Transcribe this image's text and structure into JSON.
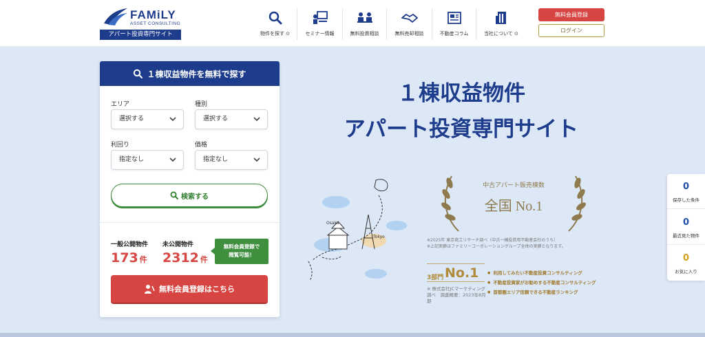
{
  "colors": {
    "brand_navy": "#1e3c8c",
    "accent_red": "#d64541",
    "accent_green": "#3d8b3d",
    "gold": "#b08a38",
    "bg": "#dde8f7"
  },
  "header": {
    "logo": {
      "name": "FAMiLY",
      "sub": "ASSET CONSULTING",
      "tagline": "アパート投資専門サイト"
    },
    "nav": [
      {
        "label": "物件を探す ⊙",
        "icon": "search-icon"
      },
      {
        "label": "セミナー情報",
        "icon": "seminar-icon"
      },
      {
        "label": "無料投資相談",
        "icon": "consultation-icon"
      },
      {
        "label": "無料売却相談",
        "icon": "handshake-icon"
      },
      {
        "label": "不動産コラム",
        "icon": "column-icon"
      },
      {
        "label": "当社について ⊙",
        "icon": "building-icon"
      }
    ],
    "register_label": "無料会員登録",
    "login_label": "ログイン"
  },
  "search": {
    "title": "１棟収益物件を無料で探す",
    "area_label": "エリア",
    "area_value": "選択する",
    "type_label": "種別",
    "type_value": "選択する",
    "yield_label": "利回り",
    "yield_value": "指定なし",
    "price_label": "価格",
    "price_value": "指定なし",
    "search_button": "検索する",
    "public_label": "一般公開物件",
    "public_count": "173",
    "private_label": "未公開物件",
    "private_count": "2312",
    "count_unit": "件",
    "member_badge_line1": "無料会員登録で",
    "member_badge_line2": "閲覧可能！",
    "member_button": "無料会員登録はこちら"
  },
  "hero": {
    "title_line1": "１棟収益物件",
    "title_line2": "アパート投資専門サイト",
    "map_label_osaka": "Osaka",
    "map_label_tokyo": "Tokyo",
    "award_caption": "中古アパート販売棟数",
    "award_main": "全国 No.1",
    "award_note_1": "※2025年 東京商工リサーチ調べ（中古一棟投資用不動産会社のうち）",
    "award_note_2": "※上記実績はファミリーコーポレーショングループ全体の実績となります。",
    "rank_prefix": "3部門",
    "rank_no1": "No.1",
    "rank_source": "※ 株式会社JCマーケティング調べ　調査概要：2023年8月期",
    "rank_items": [
      "利用してみたい不動産投資コンサルティング",
      "不動産投資家がお勧めする不動産コンサルティング",
      "首都圏エリア信頼できる不動産ランキング"
    ]
  },
  "side_widget": [
    {
      "count": "0",
      "label": "保存した条件"
    },
    {
      "count": "0",
      "label": "最近見た物件"
    },
    {
      "count": "0",
      "label": "お気に入り"
    }
  ]
}
